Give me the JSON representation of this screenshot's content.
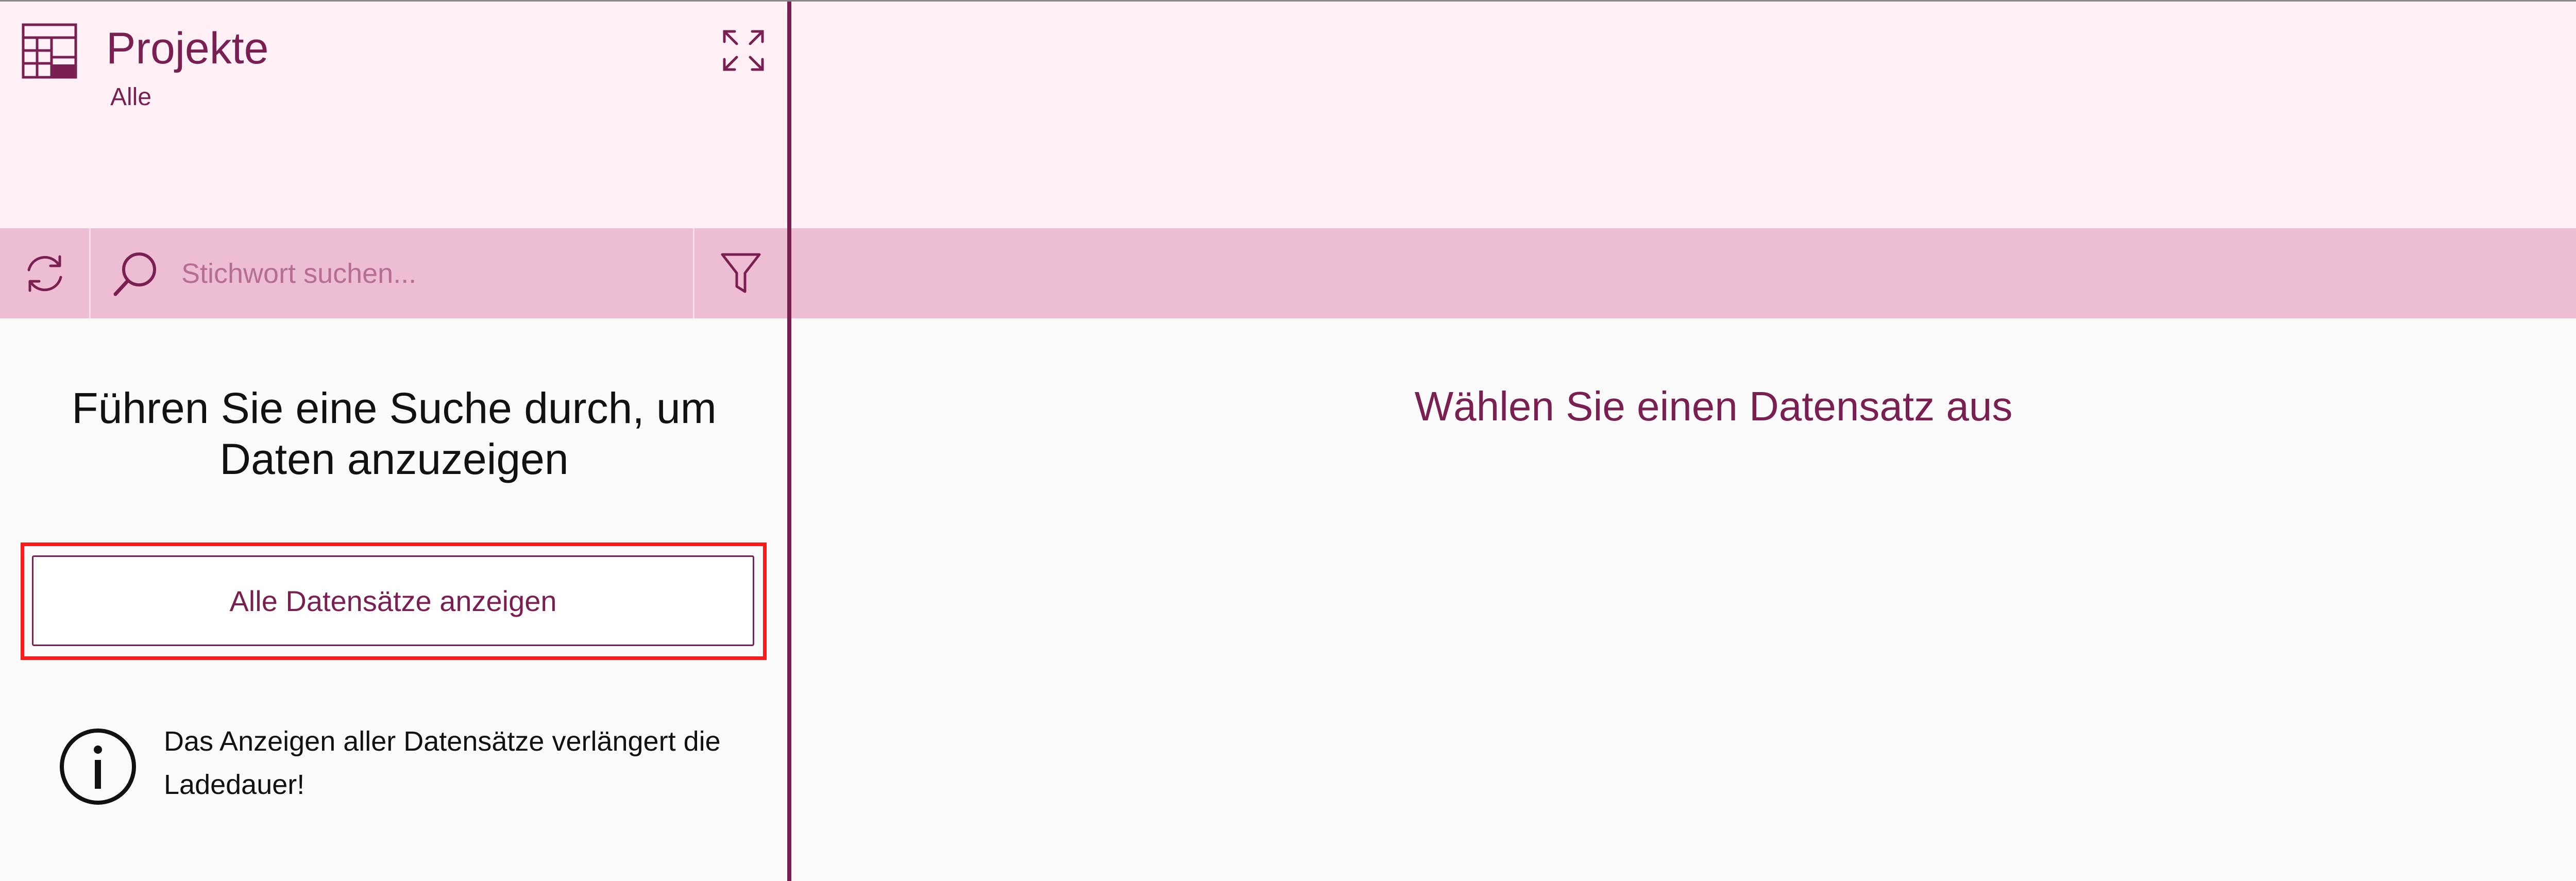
{
  "header": {
    "title": "Projekte",
    "subtitle": "Alle"
  },
  "toolbar": {
    "search_placeholder": "Stichwort suchen..."
  },
  "left_panel": {
    "prompt": "Führen Sie eine Suche durch, um Daten anzuzeigen",
    "show_all_label": "Alle Datensätze anzeigen",
    "info_text": "Das Anzeigen aller Datensätze verlängert die Ladedauer!"
  },
  "right_panel": {
    "empty_message": "Wählen Sie einen Datensatz aus"
  },
  "icons": {
    "logo": "table-layout-icon",
    "expand": "expand-icon",
    "refresh": "refresh-icon",
    "search": "search-icon",
    "filter": "filter-icon",
    "info": "info-icon"
  },
  "colors": {
    "accent": "#7a1f52",
    "header_bg": "#fff0f6",
    "toolbar_bg": "#ecbdd3",
    "content_bg": "#fafafa",
    "highlight": "#ff1a1a"
  }
}
